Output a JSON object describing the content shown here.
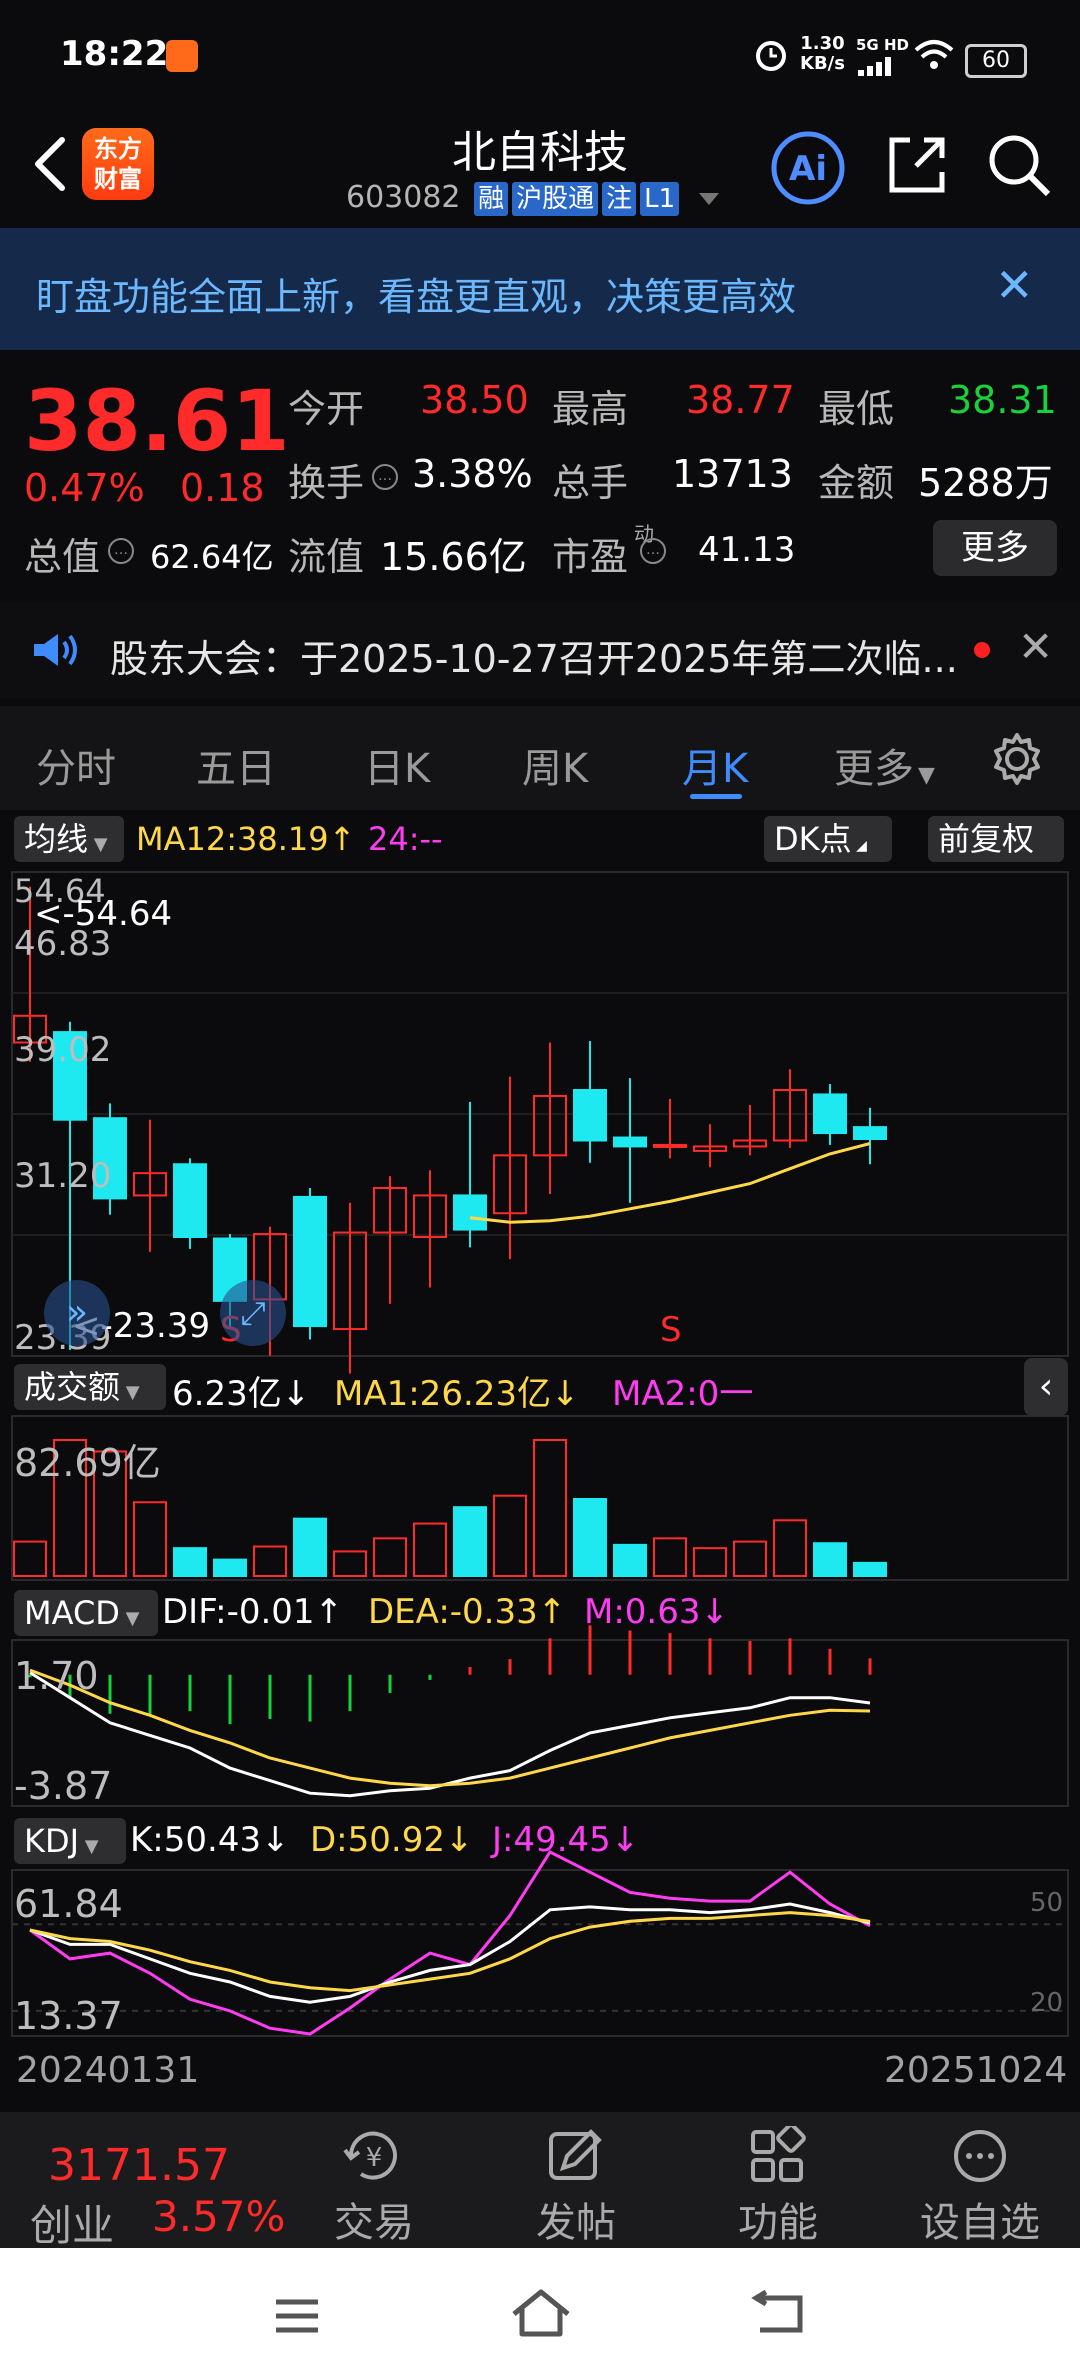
{
  "status_bar": {
    "time": "18:22",
    "net_speed_top": "1.30",
    "net_speed_unit": "KB/s",
    "net_type": "5G HD",
    "battery": "60"
  },
  "header": {
    "brand_line1": "东方",
    "brand_line2": "财富",
    "title": "北自科技",
    "code": "603082",
    "tags": [
      "融",
      "沪股通",
      "注",
      "L1"
    ]
  },
  "banner": {
    "text": "盯盘功能全面上新，看盘更直观，决策更高效"
  },
  "quote": {
    "price": "38.61",
    "change_pct": "0.47%",
    "change": "0.18",
    "open_label": "今开",
    "open": "38.50",
    "high_label": "最高",
    "high": "38.77",
    "low_label": "最低",
    "low": "38.31",
    "turnover_label": "换手",
    "turnover": "3.38%",
    "volume_label": "总手",
    "volume": "13713",
    "amount_label": "金额",
    "amount": "5288万",
    "mktcap_label": "总值",
    "mktcap": "62.64亿",
    "float_label": "流值",
    "float": "15.66亿",
    "pe_label": "市盈",
    "pe_sup": "动",
    "pe": "41.13",
    "more_label": "更多"
  },
  "notice": {
    "text": "股东大会：于2025-10-27召开2025年第二次临..."
  },
  "tabs": [
    "分时",
    "五日",
    "日K",
    "周K",
    "月K",
    "更多"
  ],
  "active_tab": "月K",
  "main_chart": {
    "ma_chip": "均线",
    "ma12": "MA12:38.19",
    "ma24": "24:--",
    "dk_chip": "DK点",
    "adjust_chip": "前复权",
    "y_labels": [
      "54.64",
      "46.83",
      "39.02",
      "31.20",
      "23.39"
    ],
    "max_label": "<-54.64",
    "min_label": "<-23.39",
    "s_marker": "S"
  },
  "volume_panel": {
    "chip": "成交额",
    "value": "6.23亿",
    "ma1": "MA1:26.23亿",
    "ma2": "MA2:0一",
    "y_label": "82.69亿"
  },
  "macd_panel": {
    "chip": "MACD",
    "dif": "DIF:-0.01",
    "dea": "DEA:-0.33",
    "m": "M:0.63",
    "y_top": "1.70",
    "y_bottom": "-3.87"
  },
  "kdj_panel": {
    "chip": "KDJ",
    "k": "K:50.43",
    "d": "D:50.92",
    "j": "J:49.45",
    "y_top": "61.84",
    "y_bottom": "13.37",
    "ref_50": "50",
    "ref_20": "20"
  },
  "date_range": {
    "start": "20240131",
    "end": "20251024"
  },
  "bottom_nav": {
    "index_value": "3171.57",
    "index_name": "创业",
    "index_pct": "3.57%",
    "items": [
      "交易",
      "发帖",
      "功能",
      "设自选"
    ]
  },
  "colors": {
    "up": "#ff2a2a",
    "down": "#1ee8f0",
    "accent": "#3f8cff",
    "ma": "#ffd84a"
  },
  "chart_data": {
    "type": "candlestick",
    "y_range": [
      23.39,
      54.64
    ],
    "candles": [
      {
        "o": 44.1,
        "c": 45.9,
        "h": 54.6,
        "l": 42.8
      },
      {
        "o": 44.8,
        "c": 38.9,
        "h": 45.5,
        "l": 23.4
      },
      {
        "o": 39.0,
        "c": 33.6,
        "h": 40.0,
        "l": 32.5
      },
      {
        "o": 33.8,
        "c": 35.3,
        "h": 38.9,
        "l": 30.0
      },
      {
        "o": 35.9,
        "c": 31.0,
        "h": 36.3,
        "l": 30.2
      },
      {
        "o": 30.9,
        "c": 26.7,
        "h": 31.2,
        "l": 24.8
      },
      {
        "o": 26.8,
        "c": 31.2,
        "h": 31.7,
        "l": 23.0
      },
      {
        "o": 33.7,
        "c": 25.0,
        "h": 34.3,
        "l": 24.1
      },
      {
        "o": 24.8,
        "c": 31.3,
        "h": 33.3,
        "l": 21.8
      },
      {
        "o": 31.3,
        "c": 34.3,
        "h": 35.1,
        "l": 26.5
      },
      {
        "o": 31.0,
        "c": 33.8,
        "h": 35.5,
        "l": 27.6
      },
      {
        "o": 33.8,
        "c": 31.5,
        "h": 40.1,
        "l": 30.3
      },
      {
        "o": 32.6,
        "c": 36.5,
        "h": 41.8,
        "l": 29.5
      },
      {
        "o": 36.5,
        "c": 40.5,
        "h": 44.1,
        "l": 33.9
      },
      {
        "o": 40.9,
        "c": 37.5,
        "h": 44.2,
        "l": 36.0
      },
      {
        "o": 37.7,
        "c": 37.1,
        "h": 41.7,
        "l": 33.3
      },
      {
        "o": 37.2,
        "c": 37.2,
        "h": 40.3,
        "l": 36.3
      },
      {
        "o": 36.8,
        "c": 37.1,
        "h": 38.6,
        "l": 35.7
      },
      {
        "o": 37.1,
        "c": 37.5,
        "h": 39.9,
        "l": 36.5
      },
      {
        "o": 37.5,
        "c": 40.9,
        "h": 42.3,
        "l": 37.0
      },
      {
        "o": 40.6,
        "c": 38.0,
        "h": 41.3,
        "l": 37.2
      },
      {
        "o": 38.4,
        "c": 37.6,
        "h": 39.7,
        "l": 35.9
      }
    ],
    "ma12": [
      null,
      null,
      null,
      null,
      null,
      null,
      null,
      null,
      null,
      null,
      null,
      32.3,
      32.0,
      32.1,
      32.4,
      32.9,
      33.4,
      34.0,
      34.6,
      35.6,
      36.6,
      37.3
    ],
    "volume": [
      {
        "v": 21,
        "up": false
      },
      {
        "v": 83,
        "up": false
      },
      {
        "v": 76,
        "up": false
      },
      {
        "v": 45,
        "up": false
      },
      {
        "v": 17,
        "up": true
      },
      {
        "v": 10,
        "up": true
      },
      {
        "v": 18,
        "up": false
      },
      {
        "v": 35,
        "up": true
      },
      {
        "v": 15,
        "up": false
      },
      {
        "v": 23,
        "up": false
      },
      {
        "v": 32,
        "up": false
      },
      {
        "v": 42,
        "up": true
      },
      {
        "v": 49,
        "up": false
      },
      {
        "v": 83,
        "up": false
      },
      {
        "v": 47,
        "up": true
      },
      {
        "v": 19,
        "up": true
      },
      {
        "v": 23,
        "up": false
      },
      {
        "v": 17,
        "up": false
      },
      {
        "v": 21,
        "up": false
      },
      {
        "v": 34,
        "up": false
      },
      {
        "v": 20,
        "up": true
      },
      {
        "v": 8,
        "up": true
      }
    ],
    "macd_dif": [
      1.2,
      0.2,
      -0.8,
      -1.3,
      -1.8,
      -2.6,
      -3.1,
      -3.6,
      -3.7,
      -3.5,
      -3.4,
      -3.0,
      -2.7,
      -1.9,
      -1.2,
      -0.9,
      -0.6,
      -0.4,
      -0.2,
      0.2,
      0.2,
      -0.01
    ],
    "macd_dea": [
      1.3,
      0.7,
      0.0,
      -0.5,
      -1.1,
      -1.6,
      -2.2,
      -2.6,
      -3.0,
      -3.2,
      -3.3,
      -3.2,
      -3.0,
      -2.6,
      -2.2,
      -1.8,
      -1.4,
      -1.1,
      -0.8,
      -0.5,
      -0.3,
      -0.33
    ],
    "macd_m": [
      -0.1,
      -0.9,
      -1.5,
      -1.6,
      -1.4,
      -1.9,
      -1.7,
      -1.8,
      -1.4,
      -0.7,
      -0.2,
      0.3,
      0.6,
      1.4,
      1.9,
      1.7,
      1.6,
      1.4,
      1.3,
      1.4,
      1.0,
      0.63
    ],
    "kdj_k": [
      48,
      43,
      43,
      38,
      33,
      30,
      25,
      23,
      25,
      30,
      34,
      36,
      44,
      55,
      56,
      55,
      55,
      54,
      55,
      57,
      54,
      50.43
    ],
    "kdj_d": [
      48,
      45,
      44,
      41,
      37,
      34,
      30,
      28,
      27,
      29,
      31,
      33,
      38,
      45,
      49,
      51,
      52,
      52,
      53,
      54,
      53,
      50.92
    ],
    "kdj_j": [
      48,
      38,
      40,
      33,
      24,
      20,
      14,
      12,
      21,
      31,
      40,
      36,
      53,
      75,
      68,
      61,
      59,
      58,
      58,
      68,
      57,
      49.45
    ]
  }
}
